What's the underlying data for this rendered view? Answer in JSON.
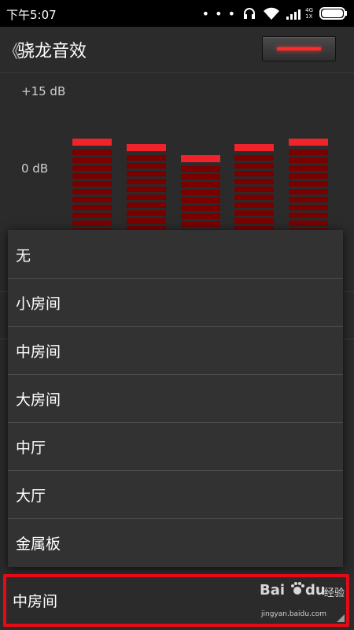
{
  "status_bar": {
    "time": "下午5:07",
    "dots": "• • •",
    "network_label": "4G\n1X",
    "icons": [
      "headset-icon",
      "wifi-icon",
      "signal-icon",
      "battery-icon"
    ]
  },
  "header": {
    "back_glyph": "《",
    "title": "骁龙音效",
    "toggle_state": "on"
  },
  "equalizer": {
    "max_label": "+15 dB",
    "zero_label": "0 dB",
    "levels_db": [
      1,
      0,
      -2,
      0,
      1
    ]
  },
  "dropdown": {
    "options": [
      "无",
      "小房间",
      "中房间",
      "大房间",
      "中厅",
      "大厅",
      "金属板"
    ]
  },
  "reverb_spinner": {
    "selected": "中房间"
  },
  "watermark": {
    "logo": "Bai",
    "logo_suffix": "du",
    "text": "经验",
    "url": "jingyan.baidu.com"
  },
  "colors": {
    "accent_red": "#f0222a",
    "highlight_border": "#e50b14",
    "background": "#2b2b2b"
  }
}
